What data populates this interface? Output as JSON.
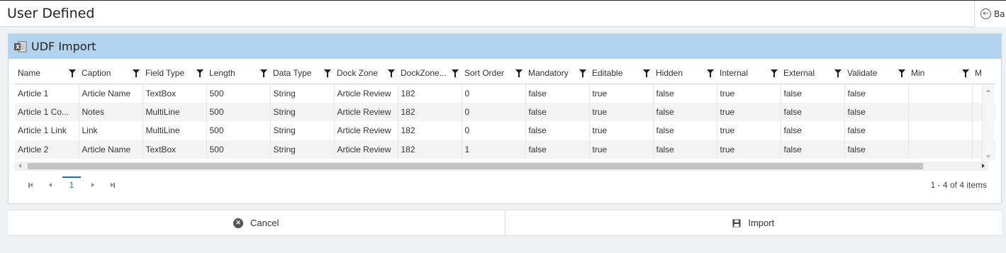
{
  "header": {
    "title": "User Defined",
    "back_label": "Ba"
  },
  "panel": {
    "title": "UDF Import",
    "icon": "excel-icon"
  },
  "grid": {
    "columns": [
      "Name",
      "Caption",
      "Field Type",
      "Length",
      "Data Type",
      "Dock Zone",
      "DockZone...",
      "Sort Order",
      "Mandatory",
      "Editable",
      "Hidden",
      "Internal",
      "External",
      "Validate",
      "Min",
      "M"
    ],
    "rows": [
      [
        "Article 1",
        "Article Name",
        "TextBox",
        "500",
        "String",
        "Article Review",
        "182",
        "0",
        "false",
        "true",
        "false",
        "true",
        "false",
        "false",
        "",
        ""
      ],
      [
        "Article 1 Co...",
        "Notes",
        "MultiLine",
        "500",
        "String",
        "Article Review",
        "182",
        "0",
        "false",
        "true",
        "false",
        "true",
        "false",
        "false",
        "",
        ""
      ],
      [
        "Article 1 Link",
        "Link",
        "MultiLine",
        "500",
        "String",
        "Article Review",
        "182",
        "0",
        "false",
        "true",
        "false",
        "true",
        "false",
        "false",
        "",
        ""
      ],
      [
        "Article 2",
        "Article Name",
        "TextBox",
        "500",
        "String",
        "Article Review",
        "182",
        "1",
        "false",
        "true",
        "false",
        "true",
        "false",
        "false",
        "",
        ""
      ]
    ]
  },
  "pager": {
    "current_page": "1",
    "info": "1 - 4 of 4 items"
  },
  "actions": {
    "cancel_label": "Cancel",
    "import_label": "Import"
  },
  "colors": {
    "panel_header": "#b3d4ef",
    "link_blue": "#1a6fb5"
  }
}
